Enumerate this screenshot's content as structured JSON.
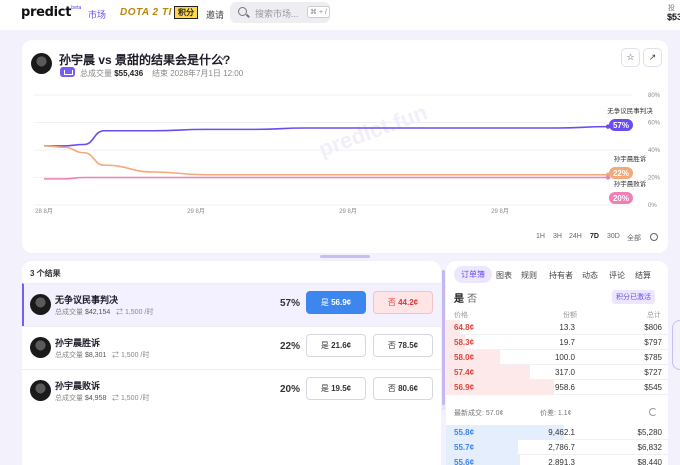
{
  "topbar": {
    "logo": "predict",
    "logo_sup": "beta",
    "nav_market": "市场",
    "nav_dota": "DOTA 2 TI",
    "nav_points": "积分",
    "nav_invite": "邀请",
    "search_placeholder": "搜索市场...",
    "search_shortcut": "⌘ + /",
    "portfolio_label": "投资",
    "portfolio_value": "$53"
  },
  "market": {
    "title": "孙宇晨 vs 景甜的结果会是什么?",
    "volume_label": "总成交量",
    "volume": "$55,436",
    "end_label": "结束",
    "end_date": "2028年7月1日 12:00"
  },
  "chart_data": {
    "type": "line",
    "x_ticks": [
      "28 8月",
      "29 8月",
      "29 8月",
      "29 8月"
    ],
    "y_ticks": [
      "80%",
      "60%",
      "40%",
      "20%",
      "0%"
    ],
    "ylim": [
      0,
      80
    ],
    "watermark": "predict.fun",
    "series": [
      {
        "name": "无争议民事判决",
        "color": "#6a4cf0",
        "label": "57%",
        "values": [
          43,
          43,
          44,
          54,
          54,
          55,
          55,
          56,
          56,
          56,
          56,
          56,
          56,
          57
        ]
      },
      {
        "name": "孙宇晨胜诉",
        "color": "#f3a979",
        "label": "22%",
        "values": [
          43,
          42,
          38,
          29,
          24,
          22,
          22,
          22,
          22,
          22,
          22,
          22,
          22,
          22
        ]
      },
      {
        "name": "孙宇晨败诉",
        "color": "#ef7fb6",
        "label": "20%",
        "values": [
          19,
          19,
          20,
          20,
          20,
          20,
          20,
          20,
          20,
          20,
          20,
          20,
          20,
          20
        ]
      }
    ]
  },
  "timeframes": [
    "1H",
    "3H",
    "24H",
    "7D",
    "30D",
    "全部"
  ],
  "outcomes": {
    "count_label": "3 个结果",
    "items": [
      {
        "name": "无争议民事判决",
        "vol_label": "总成交量",
        "volume": "$42,154",
        "rate": "1,500 /时",
        "pct": "57%",
        "yes_label": "是",
        "yes_price": "56.9¢",
        "no_label": "否",
        "no_price": "44.2¢"
      },
      {
        "name": "孙宇晨胜诉",
        "vol_label": "总成交量",
        "volume": "$8,301",
        "rate": "1,500 /时",
        "pct": "22%",
        "yes_label": "是",
        "yes_price": "21.6¢",
        "no_label": "否",
        "no_price": "78.5¢"
      },
      {
        "name": "孙宇晨败诉",
        "vol_label": "总成交量",
        "volume": "$4,958",
        "rate": "1,500 /时",
        "pct": "20%",
        "yes_label": "是",
        "yes_price": "19.5¢",
        "no_label": "否",
        "no_price": "80.6¢"
      }
    ]
  },
  "orderbook": {
    "tabs": [
      "订单簿",
      "图表",
      "规则",
      "持有者",
      "动态",
      "评论",
      "结算"
    ],
    "yes": "是",
    "no": "否",
    "points_badge": "积分已激活",
    "headers": [
      "价格",
      "份额",
      "总计"
    ],
    "asks": [
      {
        "price": "64.8¢",
        "shares": "13.3",
        "total": "$806",
        "depth": 0.12
      },
      {
        "price": "58.3¢",
        "shares": "19.7",
        "total": "$797",
        "depth": 0.16
      },
      {
        "price": "58.0¢",
        "shares": "100.0",
        "total": "$785",
        "depth": 0.45
      },
      {
        "price": "57.4¢",
        "shares": "317.0",
        "total": "$727",
        "depth": 0.7
      },
      {
        "price": "56.9¢",
        "shares": "958.6",
        "total": "$545",
        "depth": 0.9
      }
    ],
    "last_trade": "最新成交: 57.0¢",
    "spread": "价差: 1.1¢",
    "bids": [
      {
        "price": "55.8¢",
        "shares": "9,462.1",
        "total": "$5,280",
        "depth": 0.98
      },
      {
        "price": "55.7¢",
        "shares": "2,786.7",
        "total": "$6,832",
        "depth": 0.6
      },
      {
        "price": "55.6¢",
        "shares": "2,891.3",
        "total": "$8,440",
        "depth": 0.62
      }
    ]
  }
}
